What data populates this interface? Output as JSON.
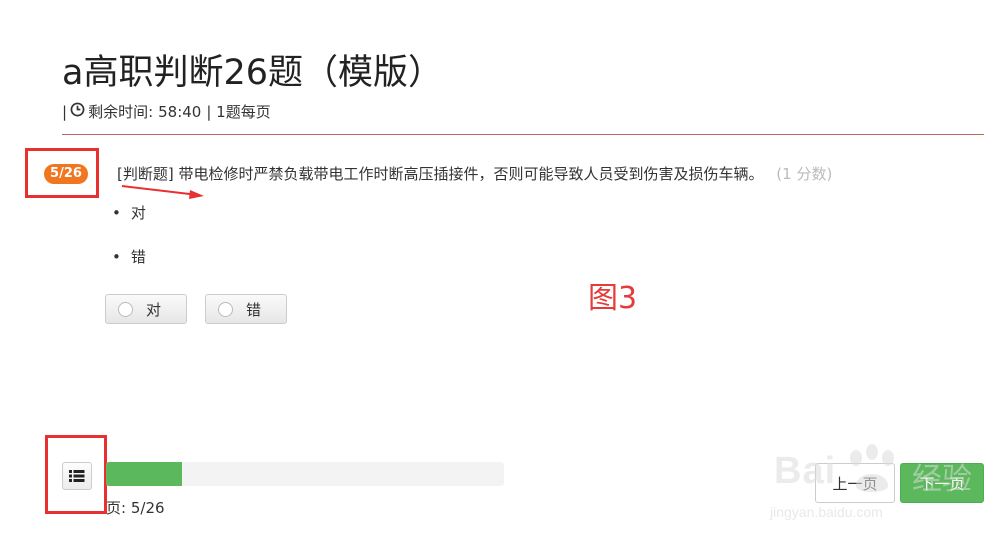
{
  "exam": {
    "title": "a高职判断26题（模版）",
    "meta_prefix": "|",
    "remaining_label": "剩余时间:",
    "remaining_time": "58:40",
    "per_page": "| 1题每页"
  },
  "question": {
    "number_badge": "5/26",
    "type_label": "[判断题]",
    "text": "带电检修时严禁负载带电工作时断高压插接件，否则可能导致人员受到伤害及损伤车辆。",
    "score": "(1 分数)",
    "options": [
      "对",
      "错"
    ],
    "answer_buttons": [
      "对",
      "错"
    ]
  },
  "annotation": {
    "figure_label": "图3",
    "colors": {
      "annotation_red": "#e93030",
      "badge_orange": "#f0761f",
      "progress_green": "#5cb85c"
    }
  },
  "footer": {
    "progress_fraction": 0.19,
    "page_label": "页:",
    "page_value": "5/26",
    "prev_label": "上一页",
    "next_label": "下一页"
  },
  "watermark": {
    "brand": "Bai",
    "brand_suffix": "经验",
    "url": "jingyan.baidu.com"
  }
}
